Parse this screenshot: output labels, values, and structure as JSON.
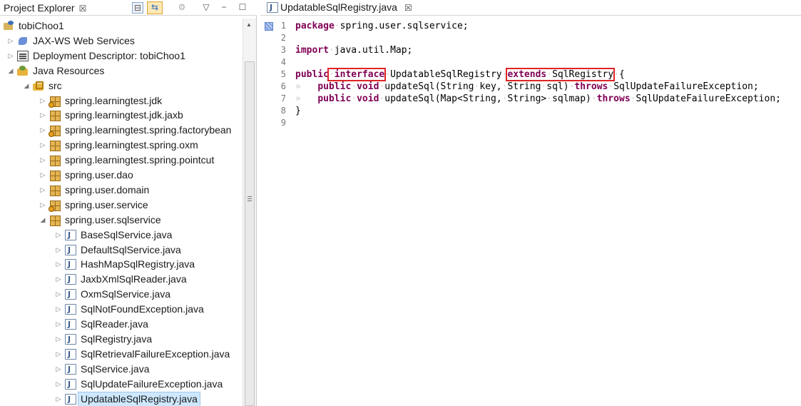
{
  "explorer": {
    "title": "Project Explorer",
    "close_glyph": "☒",
    "toolbar": {
      "collapse_glyph": "⊟",
      "link_glyph": "⇆",
      "focus_glyph": "⚙",
      "menu_glyph": "▽",
      "min_glyph": "−",
      "max_glyph": "☐"
    },
    "tree": [
      {
        "label": "tobiChoo1",
        "icon": "project-icon",
        "twisty": ""
      },
      {
        "label": "JAX-WS Web Services",
        "icon": "web-services-icon",
        "twisty": "▷"
      },
      {
        "label": "Deployment Descriptor: tobiChoo1",
        "icon": "deployment-descriptor-icon",
        "twisty": "▷"
      },
      {
        "label": "Java Resources",
        "icon": "java-resources-icon",
        "twisty": "◢"
      },
      {
        "label": "src",
        "icon": "source-folder-icon",
        "twisty": "◢"
      },
      {
        "label": "spring.learningtest.jdk",
        "icon": "package-icon",
        "twisty": "▷",
        "error": true
      },
      {
        "label": "spring.learningtest.jdk.jaxb",
        "icon": "package-icon",
        "twisty": "▷"
      },
      {
        "label": "spring.learningtest.spring.factorybean",
        "icon": "package-icon",
        "twisty": "▷",
        "error": true
      },
      {
        "label": "spring.learningtest.spring.oxm",
        "icon": "package-icon",
        "twisty": "▷"
      },
      {
        "label": "spring.learningtest.spring.pointcut",
        "icon": "package-icon",
        "twisty": "▷"
      },
      {
        "label": "spring.user.dao",
        "icon": "package-icon",
        "twisty": "▷"
      },
      {
        "label": "spring.user.domain",
        "icon": "package-icon",
        "twisty": "▷"
      },
      {
        "label": "spring.user.service",
        "icon": "package-icon",
        "twisty": "▷",
        "error": true
      },
      {
        "label": "spring.user.sqlservice",
        "icon": "package-icon",
        "twisty": "◢"
      },
      {
        "label": "BaseSqlService.java",
        "icon": "java-file-icon",
        "twisty": "▷"
      },
      {
        "label": "DefaultSqlService.java",
        "icon": "java-file-icon",
        "twisty": "▷"
      },
      {
        "label": "HashMapSqlRegistry.java",
        "icon": "java-file-icon",
        "twisty": "▷"
      },
      {
        "label": "JaxbXmlSqlReader.java",
        "icon": "java-file-icon",
        "twisty": "▷"
      },
      {
        "label": "OxmSqlService.java",
        "icon": "java-file-icon",
        "twisty": "▷"
      },
      {
        "label": "SqlNotFoundException.java",
        "icon": "java-file-icon",
        "twisty": "▷"
      },
      {
        "label": "SqlReader.java",
        "icon": "java-file-icon",
        "twisty": "▷"
      },
      {
        "label": "SqlRegistry.java",
        "icon": "java-file-icon",
        "twisty": "▷"
      },
      {
        "label": "SqlRetrievalFailureException.java",
        "icon": "java-file-icon",
        "twisty": "▷"
      },
      {
        "label": "SqlService.java",
        "icon": "java-file-icon",
        "twisty": "▷"
      },
      {
        "label": "SqlUpdateFailureException.java",
        "icon": "java-file-icon",
        "twisty": "▷"
      },
      {
        "label": "UpdatableSqlRegistry.java",
        "icon": "java-file-icon",
        "twisty": "▷",
        "selected": true
      }
    ]
  },
  "editor": {
    "tab_title": "UpdatableSqlRegistry.java",
    "close_glyph": "☒",
    "line_numbers": [
      "1",
      "2",
      "3",
      "4",
      "5",
      "6",
      "7",
      "8",
      "9"
    ],
    "lines": {
      "l1_kw": "package",
      "l1_rest": "spring.user.sqlservice;",
      "l3_kw": "import",
      "l3_rest": "java.util.Map;",
      "l5_kw1": "public",
      "l5_kw2": "interface",
      "l5_name": "UpdatableSqlRegistry",
      "l5_kw3": "extends",
      "l5_super": "SqlRegistry",
      "l5_brace": "{",
      "l6_kw1": "public",
      "l6_kw2": "void",
      "l6_a": "updateSql(String",
      "l6_b": "key,",
      "l6_c": "String",
      "l6_d": "sql)",
      "l6_kw3": "throws",
      "l6_e": "SqlUpdateFailureException;",
      "l7_kw1": "public",
      "l7_kw2": "void",
      "l7_a": "updateSql(Map<String,",
      "l7_b": "String>",
      "l7_c": "sqlmap)",
      "l7_kw3": "throws",
      "l7_e": "SqlUpdateFailureException;",
      "l8": "}"
    },
    "whitespace_dot": "·",
    "tab_glyph": "»"
  },
  "colors": {
    "keyword": "#7f0055",
    "highlight_box": "#e02424",
    "selection": "#cde8ff"
  }
}
